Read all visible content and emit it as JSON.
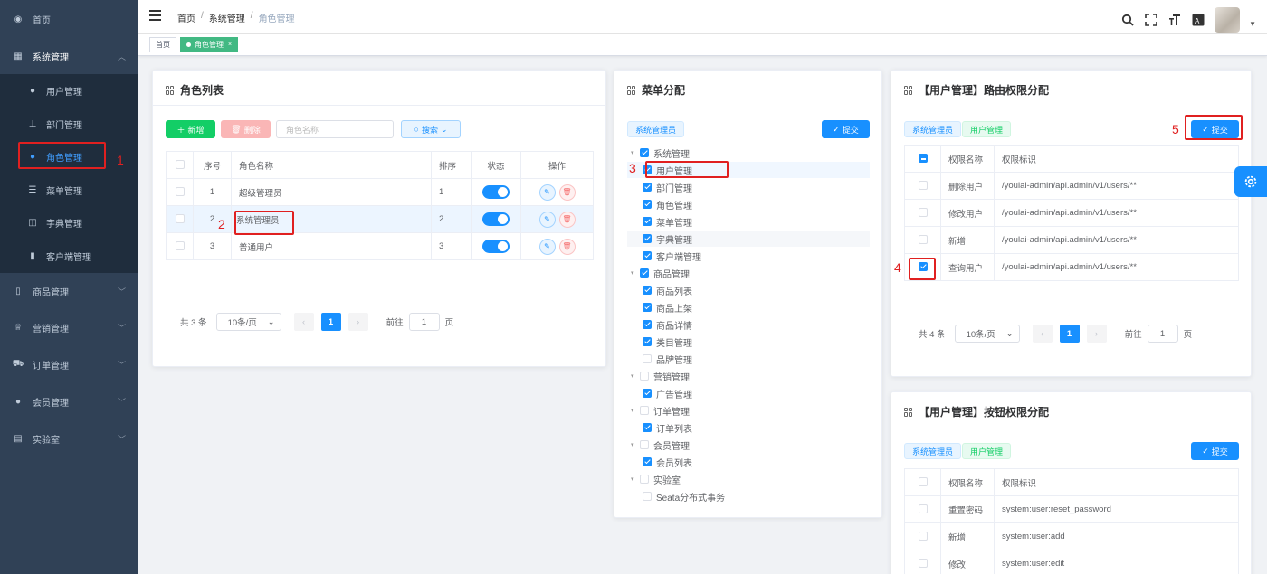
{
  "sidebar": {
    "items": [
      {
        "label": "首页",
        "icon": "dashboard-icon",
        "glyph": "◉"
      },
      {
        "label": "系统管理",
        "icon": "grid-icon",
        "glyph": "▦"
      },
      {
        "label": "用户管理",
        "icon": "user-icon",
        "glyph": "●"
      },
      {
        "label": "部门管理",
        "icon": "tree-icon",
        "glyph": "⊥"
      },
      {
        "label": "角色管理",
        "icon": "role-icon",
        "glyph": "●"
      },
      {
        "label": "菜单管理",
        "icon": "menu-icon",
        "glyph": "☰"
      },
      {
        "label": "字典管理",
        "icon": "book-icon",
        "glyph": "◫"
      },
      {
        "label": "客户端管理",
        "icon": "client-icon",
        "glyph": "▮"
      },
      {
        "label": "商品管理",
        "icon": "phone-icon",
        "glyph": "▯"
      },
      {
        "label": "营销管理",
        "icon": "marketing-icon",
        "glyph": "♕"
      },
      {
        "label": "订单管理",
        "icon": "cart-icon",
        "glyph": "⛟"
      },
      {
        "label": "会员管理",
        "icon": "member-icon",
        "glyph": "●"
      },
      {
        "label": "实验室",
        "icon": "lab-icon",
        "glyph": "▤"
      }
    ]
  },
  "annotations": {
    "n1": "1",
    "n2": "2",
    "n3": "3",
    "n4": "4",
    "n5": "5"
  },
  "header": {
    "breadcrumb": [
      "首页",
      "系统管理",
      "角色管理"
    ],
    "sep": "/"
  },
  "tags": {
    "home": "首页",
    "active": "角色管理",
    "close": "×"
  },
  "roles": {
    "title": "角色列表",
    "add": "新增",
    "delete": "删除",
    "search_placeholder": "角色名称",
    "search": "搜索",
    "columns": [
      "序号",
      "角色名称",
      "排序",
      "状态",
      "操作"
    ],
    "rows": [
      {
        "no": "1",
        "name": "超级管理员",
        "sort": "1"
      },
      {
        "no": "2",
        "name": "系统管理员",
        "sort": "2"
      },
      {
        "no": "3",
        "name": "普通用户",
        "sort": "3"
      }
    ],
    "pager": {
      "total": "共 3 条",
      "size": "10条/页",
      "page": "1",
      "goto": "前往",
      "goto_val": "1",
      "unit": "页"
    }
  },
  "menu": {
    "title": "菜单分配",
    "role_tag": "系统管理员",
    "submit": "提交",
    "tree": [
      {
        "label": "系统管理",
        "level": 0,
        "checked": true
      },
      {
        "label": "用户管理",
        "level": 1,
        "checked": true
      },
      {
        "label": "部门管理",
        "level": 1,
        "checked": true
      },
      {
        "label": "角色管理",
        "level": 1,
        "checked": true
      },
      {
        "label": "菜单管理",
        "level": 1,
        "checked": true
      },
      {
        "label": "字典管理",
        "level": 1,
        "checked": true
      },
      {
        "label": "客户端管理",
        "level": 1,
        "checked": true
      },
      {
        "label": "商品管理",
        "level": 0,
        "checked": true
      },
      {
        "label": "商品列表",
        "level": 1,
        "checked": true
      },
      {
        "label": "商品上架",
        "level": 1,
        "checked": true
      },
      {
        "label": "商品详情",
        "level": 1,
        "checked": true
      },
      {
        "label": "类目管理",
        "level": 1,
        "checked": true
      },
      {
        "label": "品牌管理",
        "level": 1,
        "checked": false
      },
      {
        "label": "营销管理",
        "level": 0,
        "checked": false
      },
      {
        "label": "广告管理",
        "level": 1,
        "checked": true
      },
      {
        "label": "订单管理",
        "level": 0,
        "checked": false
      },
      {
        "label": "订单列表",
        "level": 1,
        "checked": true
      },
      {
        "label": "会员管理",
        "level": 0,
        "checked": false
      },
      {
        "label": "会员列表",
        "level": 1,
        "checked": true
      },
      {
        "label": "实验室",
        "level": 0,
        "checked": false
      },
      {
        "label": "Seata分布式事务",
        "level": 1,
        "checked": false
      }
    ]
  },
  "route_perm": {
    "title": "【用户管理】路由权限分配",
    "tag_role": "系统管理员",
    "tag_menu": "用户管理",
    "submit": "提交",
    "columns": [
      "权限名称",
      "权限标识"
    ],
    "rows": [
      {
        "name": "删除用户",
        "perm": "/youlai-admin/api.admin/v1/users/**",
        "checked": false
      },
      {
        "name": "修改用户",
        "perm": "/youlai-admin/api.admin/v1/users/**",
        "checked": false
      },
      {
        "name": "新增",
        "perm": "/youlai-admin/api.admin/v1/users/**",
        "checked": false
      },
      {
        "name": "查询用户",
        "perm": "/youlai-admin/api.admin/v1/users/**",
        "checked": true
      }
    ],
    "pager": {
      "total": "共 4 条",
      "size": "10条/页",
      "page": "1",
      "goto": "前往",
      "goto_val": "1",
      "unit": "页"
    }
  },
  "btn_perm": {
    "title": "【用户管理】按钮权限分配",
    "tag_role": "系统管理员",
    "tag_menu": "用户管理",
    "submit": "提交",
    "columns": [
      "权限名称",
      "权限标识"
    ],
    "rows": [
      {
        "name": "重置密码",
        "perm": "system:user:reset_password"
      },
      {
        "name": "新增",
        "perm": "system:user:add"
      },
      {
        "name": "修改",
        "perm": "system:user:edit"
      }
    ]
  },
  "colors": {
    "sidebar_bg": "#304156",
    "primary": "#1890ff",
    "success": "#13ce66",
    "danger": "#f56c6c",
    "annotation": "#e02020"
  }
}
